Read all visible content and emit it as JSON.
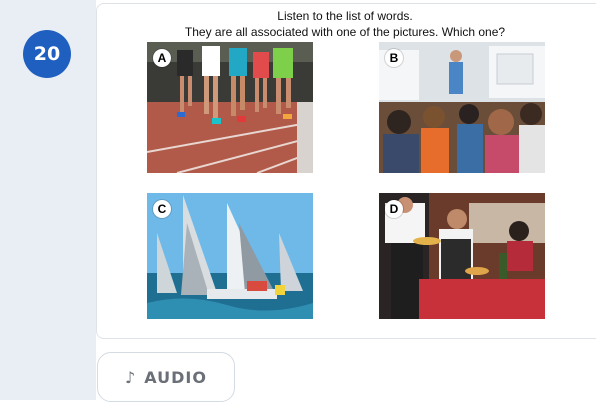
{
  "question": {
    "number": "20"
  },
  "instructions": {
    "line1": "Listen to the list of words.",
    "line2": "They are all associated with one of the pictures. Which one?"
  },
  "options": [
    {
      "label": "A",
      "subject": "runners-race"
    },
    {
      "label": "B",
      "subject": "classroom-audience"
    },
    {
      "label": "C",
      "subject": "sailboat-race"
    },
    {
      "label": "D",
      "subject": "restaurant-waiter"
    }
  ],
  "audio_button": {
    "icon": "music-note-icon",
    "glyph": "♪",
    "label": "AUDIO"
  },
  "colors": {
    "question_badge": "#1f5fbf",
    "left_column": "#e9eef4"
  }
}
